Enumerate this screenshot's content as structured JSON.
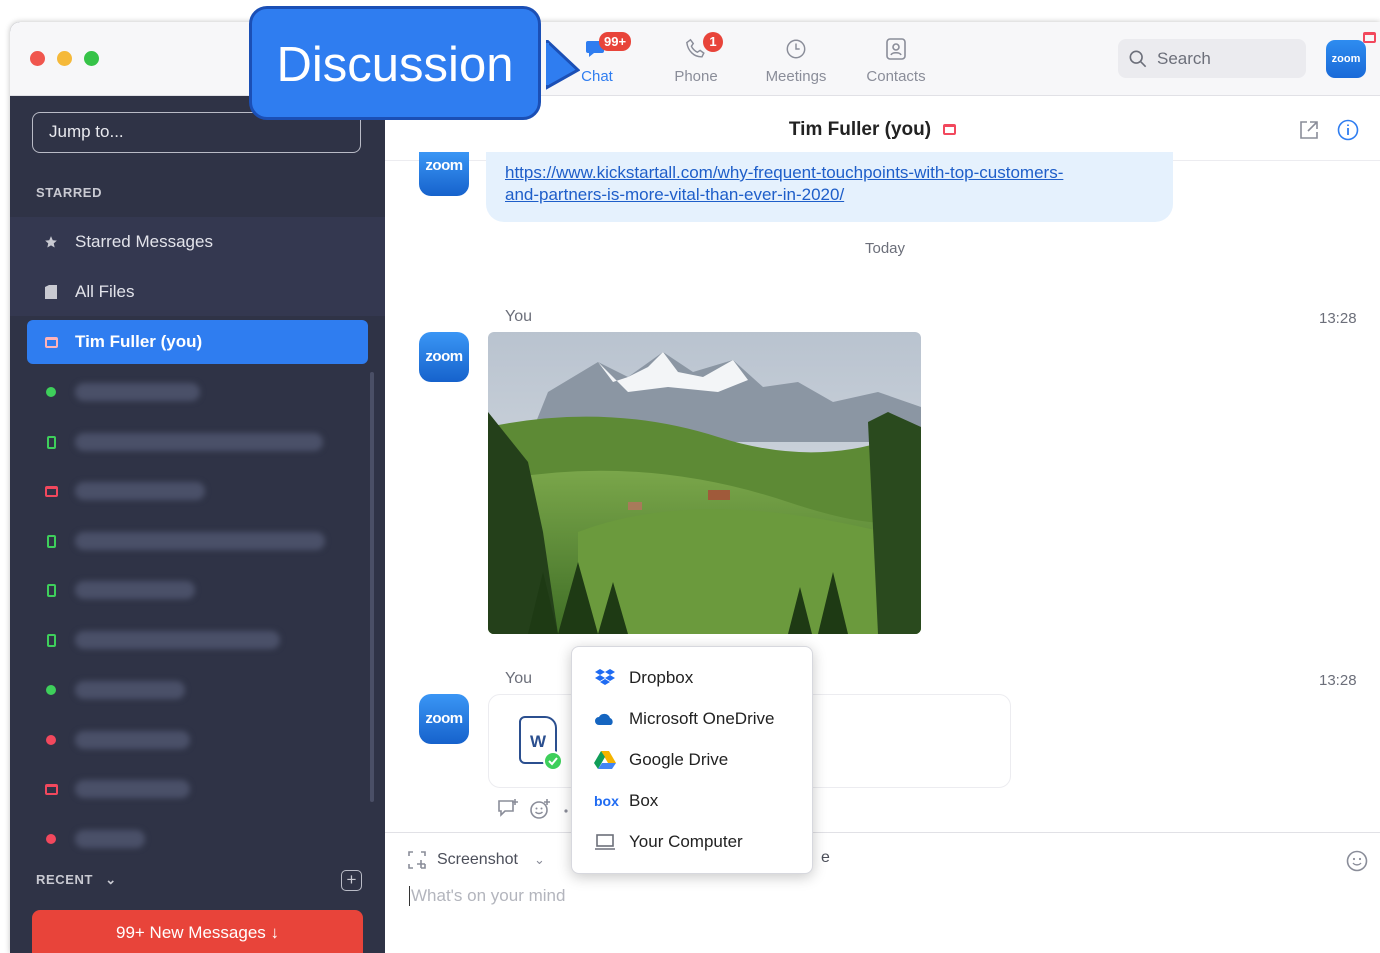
{
  "callout": {
    "label": "Discussion"
  },
  "sidebar": {
    "jump_placeholder": "Jump to...",
    "starred_label": "STARRED",
    "items": [
      {
        "label": "Starred Messages"
      },
      {
        "label": "All Files"
      },
      {
        "label": "Tim Fuller  (you)"
      }
    ],
    "recent_label": "RECENT",
    "new_messages": "99+ New Messages ↓"
  },
  "topnav": {
    "tabs": [
      {
        "label": "Chat",
        "badge": "99+"
      },
      {
        "label": "Phone",
        "badge": "1"
      },
      {
        "label": "Meetings"
      },
      {
        "label": "Contacts"
      }
    ],
    "search_placeholder": "Search",
    "avatar_text": "zoom"
  },
  "chat": {
    "title": "Tim Fuller (you)",
    "link_line1": "https://www.kickstartall.com/why-frequent-touchpoints-with-top-customers-",
    "link_line2": "and-partners-is-more-vital-than-ever-in-2020/",
    "date_divider": "Today",
    "avatar_text": "zoom",
    "messages": [
      {
        "sender": "You",
        "time": "13:28"
      },
      {
        "sender": "You",
        "time": "13:28",
        "file_icon": "W"
      }
    ]
  },
  "composer": {
    "screenshot_label": "Screenshot",
    "placeholder": "What's on your mind"
  },
  "file_menu": {
    "items": [
      {
        "label": "Dropbox",
        "icon": "dropbox-icon"
      },
      {
        "label": "Microsoft OneDrive",
        "icon": "onedrive-icon"
      },
      {
        "label": "Google Drive",
        "icon": "google-drive-icon"
      },
      {
        "label": "Box",
        "icon": "box-icon"
      },
      {
        "label": "Your Computer",
        "icon": "computer-icon"
      }
    ]
  },
  "colors": {
    "accent": "#2f7df0",
    "sidebar_bg": "#2f3346",
    "alert": "#e8443a",
    "online": "#3ecf5b"
  }
}
